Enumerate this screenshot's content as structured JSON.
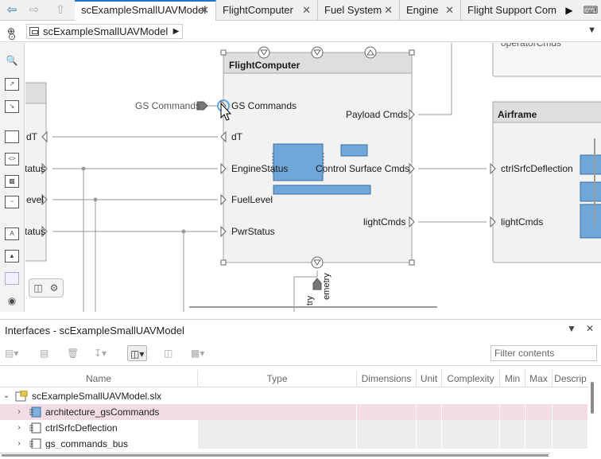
{
  "tabs": [
    {
      "label": "scExampleSmallUAVModel",
      "active": true
    },
    {
      "label": "FlightComputer"
    },
    {
      "label": "Fuel System"
    },
    {
      "label": "Engine"
    },
    {
      "label": "Flight Support Com"
    }
  ],
  "breadcrumb": {
    "label": "scExampleSmallUAVModel"
  },
  "canvas": {
    "flight_computer": {
      "title": "FlightComputer",
      "ports_left": [
        "GS Commands",
        "dT",
        "EngineStatus",
        "FuelLevel",
        "PwrStatus"
      ],
      "ports_right": [
        "Payload Cmds",
        "Control Surface Cmds",
        "lightCmds"
      ]
    },
    "external_port": "GS Commands",
    "left_block_ports": [
      "dT",
      "tatus",
      "evel",
      "tatus"
    ],
    "airframe": {
      "title": "Airframe",
      "ports": [
        "ctrlSrfcDeflection",
        "lightCmds"
      ]
    },
    "top_block_port": "operatorCmds",
    "bottom_port_labels": [
      "try",
      "emetry"
    ]
  },
  "interfaces_panel": {
    "title": "Interfaces - scExampleSmallUAVModel",
    "filter_placeholder": "Filter contents",
    "columns": [
      "Name",
      "Type",
      "Dimensions",
      "Unit",
      "Complexity",
      "Min",
      "Max",
      "Descrip"
    ],
    "rows": [
      {
        "name": "scExampleSmallUAVModel.slx",
        "level": 0,
        "expanded": true
      },
      {
        "name": "architecture_gsCommands",
        "level": 1,
        "selected": true
      },
      {
        "name": "ctrlSrfcDeflection",
        "level": 1
      },
      {
        "name": "gs_commands_bus",
        "level": 1
      }
    ]
  },
  "colors": {
    "accent": "#1e73d6",
    "block_fill": "#f2f2f2",
    "block_border": "#a6a6a6",
    "subsystem_fill": "#6fa7d9",
    "row_selected": "#f2dde7"
  }
}
